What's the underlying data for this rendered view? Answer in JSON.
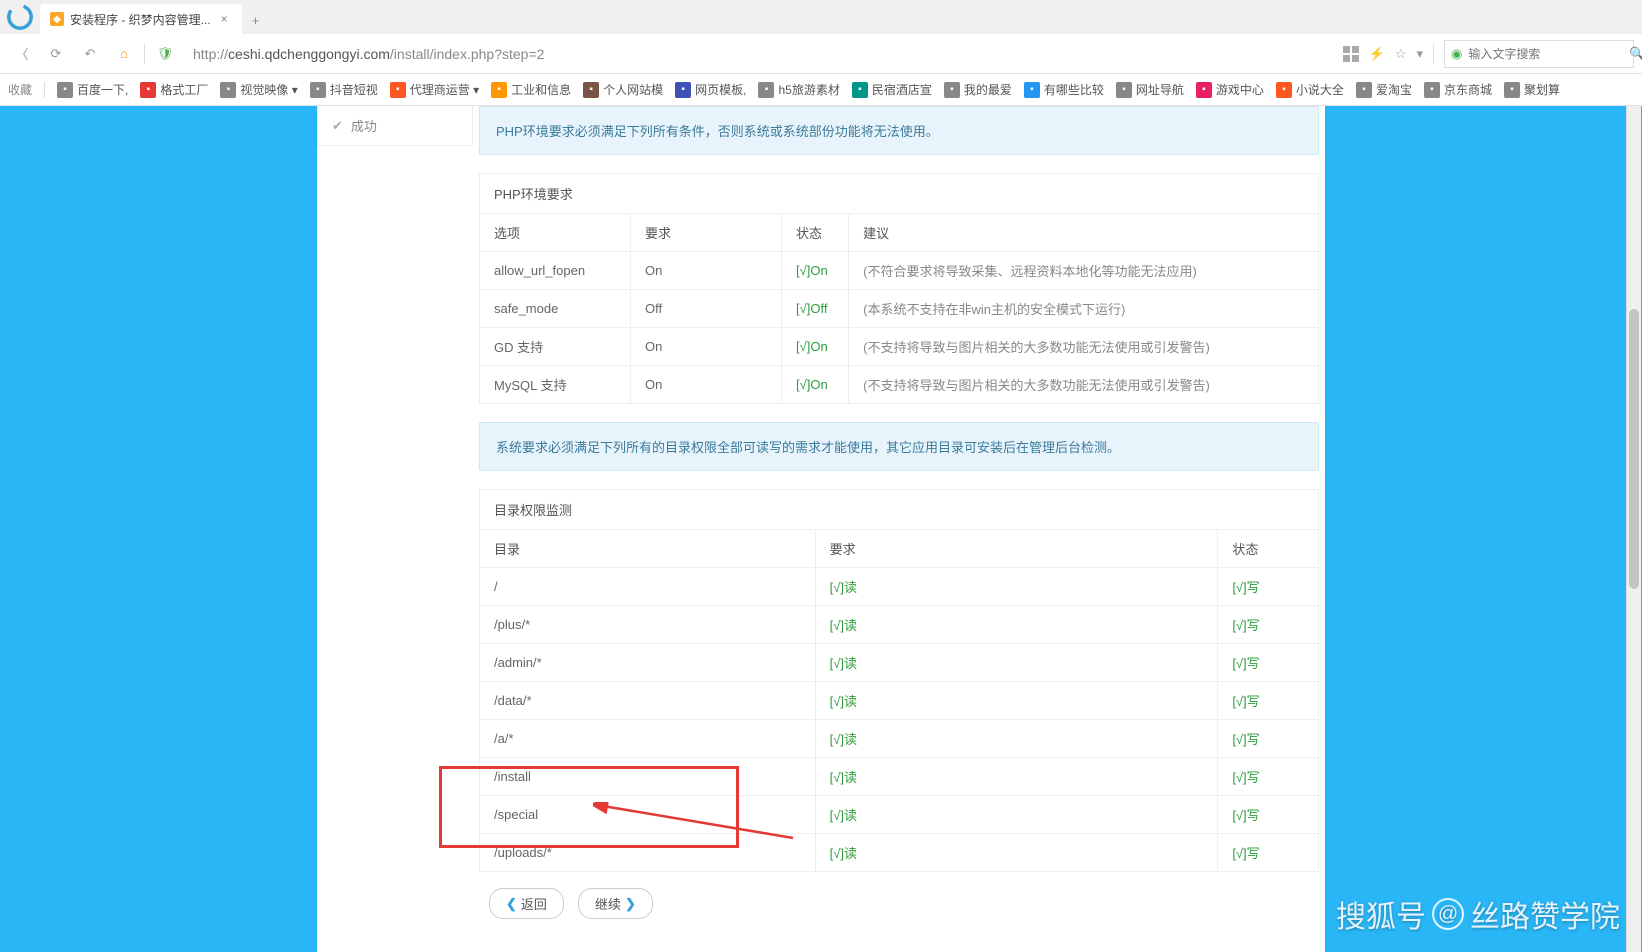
{
  "browser": {
    "tab_title": "安装程序 - 织梦内容管理...",
    "url_prefix": "http://",
    "url_host": "ceshi.qdchenggongyi.com",
    "url_path": "/install/index.php?step=2",
    "search_placeholder": "输入文字搜索"
  },
  "bookmarks": {
    "fav": "收藏",
    "items": [
      {
        "label": "百度一下,",
        "color": "#888"
      },
      {
        "label": "格式工厂",
        "color": "#e53935"
      },
      {
        "label": "视觉映像 ▾",
        "color": "#888"
      },
      {
        "label": "抖音短视",
        "color": "#888"
      },
      {
        "label": "代理商运营 ▾",
        "color": "#ff5722"
      },
      {
        "label": "工业和信息",
        "color": "#ff9800"
      },
      {
        "label": "个人网站模",
        "color": "#795548"
      },
      {
        "label": "网页模板,",
        "color": "#3f51b5"
      },
      {
        "label": "h5旅游素材",
        "color": "#888"
      },
      {
        "label": "民宿酒店宣",
        "color": "#009688"
      },
      {
        "label": "我的最爱",
        "color": "#888"
      },
      {
        "label": "有哪些比较",
        "color": "#2196f3"
      },
      {
        "label": "网址导航",
        "color": "#888"
      },
      {
        "label": "游戏中心",
        "color": "#e91e63"
      },
      {
        "label": "小说大全",
        "color": "#ff5722"
      },
      {
        "label": "爱淘宝",
        "color": "#888"
      },
      {
        "label": "京东商城",
        "color": "#888"
      },
      {
        "label": "聚划算",
        "color": "#888"
      }
    ]
  },
  "sidebar": {
    "step": "成功"
  },
  "alerts": {
    "env": "PHP环境要求必须满足下列所有条件，否则系统或系统部份功能将无法使用。",
    "dir": "系统要求必须满足下列所有的目录权限全部可读写的需求才能使用，其它应用目录可安装后在管理后台检测。"
  },
  "php_table": {
    "title": "PHP环境要求",
    "headers": [
      "选项",
      "要求",
      "状态",
      "建议"
    ],
    "rows": [
      {
        "opt": "allow_url_fopen",
        "req": "On",
        "stat": "[√]On",
        "sug": "(不符合要求将导致采集、远程资料本地化等功能无法应用)"
      },
      {
        "opt": "safe_mode",
        "req": "Off",
        "stat": "[√]Off",
        "sug": "(本系统不支持在非win主机的安全模式下运行)"
      },
      {
        "opt": "GD 支持",
        "req": "On",
        "stat": "[√]On",
        "sug": "(不支持将导致与图片相关的大多数功能无法使用或引发警告)"
      },
      {
        "opt": "MySQL 支持",
        "req": "On",
        "stat": "[√]On",
        "sug": "(不支持将导致与图片相关的大多数功能无法使用或引发警告)"
      }
    ]
  },
  "dir_table": {
    "title": "目录权限监测",
    "headers": [
      "目录",
      "要求",
      "状态"
    ],
    "rows": [
      {
        "dir": "/",
        "req": "[√]读",
        "stat": "[√]写"
      },
      {
        "dir": "/plus/*",
        "req": "[√]读",
        "stat": "[√]写"
      },
      {
        "dir": "/admin/*",
        "req": "[√]读",
        "stat": "[√]写"
      },
      {
        "dir": "/data/*",
        "req": "[√]读",
        "stat": "[√]写"
      },
      {
        "dir": "/a/*",
        "req": "[√]读",
        "stat": "[√]写"
      },
      {
        "dir": "/install",
        "req": "[√]读",
        "stat": "[√]写"
      },
      {
        "dir": "/special",
        "req": "[√]读",
        "stat": "[√]写"
      },
      {
        "dir": "/uploads/*",
        "req": "[√]读",
        "stat": "[√]写"
      }
    ]
  },
  "buttons": {
    "back": "返回",
    "continue": "继续"
  },
  "watermark": {
    "prefix": "搜狐号",
    "suffix": "丝路赞学院"
  }
}
